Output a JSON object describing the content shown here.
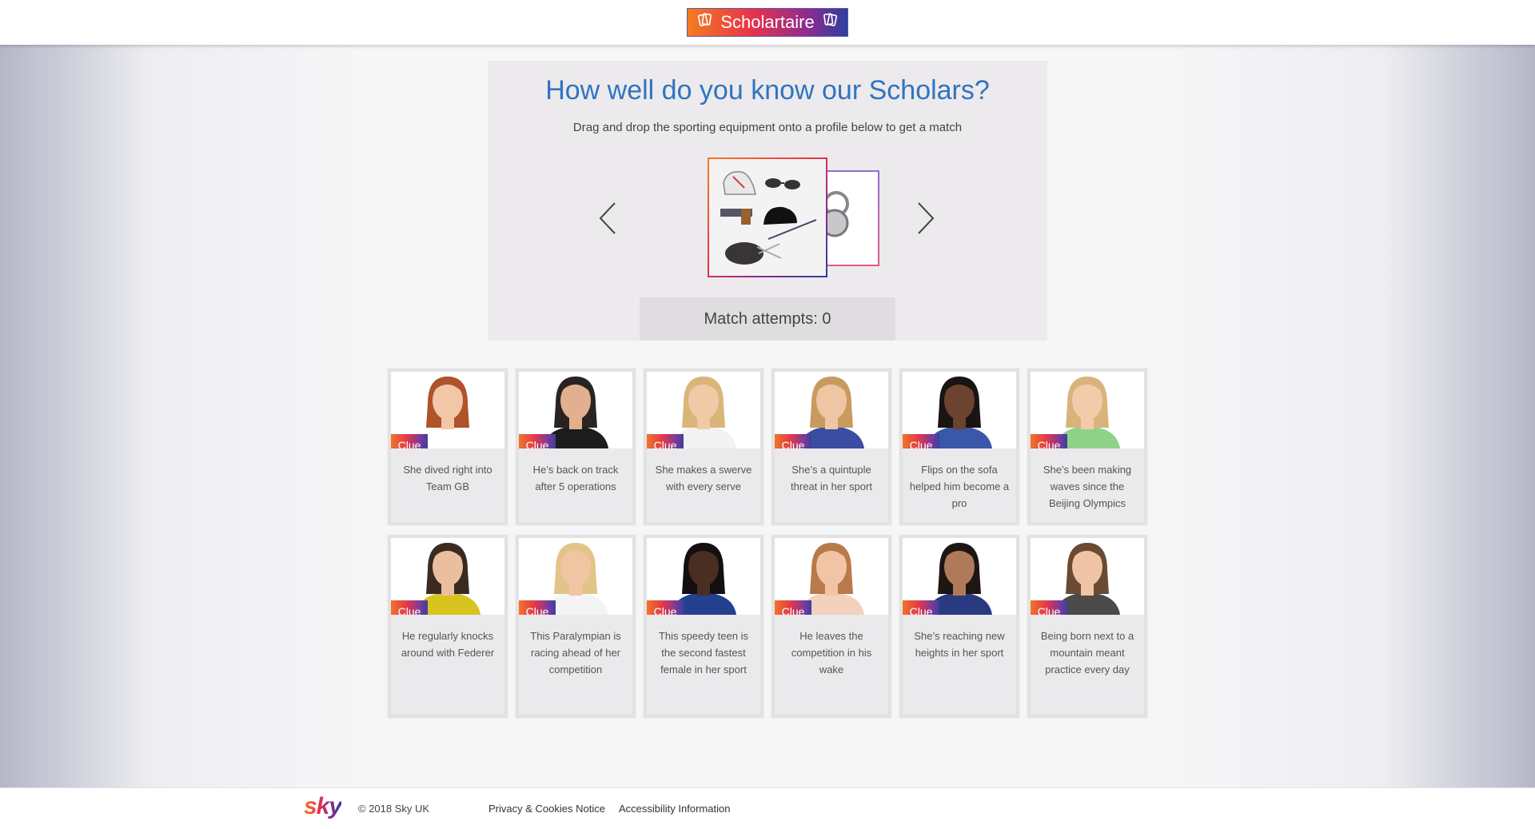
{
  "header": {
    "logo_text": "Scholartaire",
    "logo_icon": "card-icon"
  },
  "panel": {
    "title": "How well do you know our Scholars?",
    "subtitle": "Drag and drop the sporting equipment onto a profile below to get a match",
    "attempts_label": "Match attempts: 0",
    "prev_icon": "chevron-left-icon",
    "next_icon": "chevron-right-icon"
  },
  "clue_label": "Clue",
  "profiles": [
    {
      "desc": "She dived right into Team GB",
      "hair": "#b0522a",
      "skin": "#f1c7a8",
      "top": "#ffffff"
    },
    {
      "desc": "He’s back on track after 5 operations",
      "hair": "#2a2421",
      "skin": "#e2b08e",
      "top": "#1c1c1c"
    },
    {
      "desc": "She makes a swerve with every serve",
      "hair": "#d9b678",
      "skin": "#f0c9a6",
      "top": "#f2f2f2"
    },
    {
      "desc": "She’s a quintuple threat in her sport",
      "hair": "#c89a5e",
      "skin": "#efc6a4",
      "top": "#3b4da0"
    },
    {
      "desc": "Flips on the sofa helped him become a pro",
      "hair": "#1a1412",
      "skin": "#6b4330",
      "top": "#3a57a8"
    },
    {
      "desc": "She’s been making waves since the Beijing Olympics",
      "hair": "#d8b47c",
      "skin": "#f2cbab",
      "top": "#8ed28a"
    },
    {
      "desc": "He regularly knocks around with Federer",
      "hair": "#3a2a20",
      "skin": "#eabf9e",
      "top": "#d8c420"
    },
    {
      "desc": "This Paralympian is racing ahead of her competition",
      "hair": "#e2c48a",
      "skin": "#f0c5a2",
      "top": "#f4f4f4"
    },
    {
      "desc": "This speedy teen is the second fastest female in her sport",
      "hair": "#141010",
      "skin": "#4a2e22",
      "top": "#23418e"
    },
    {
      "desc": "He leaves the competition in his wake",
      "hair": "#b87a4a",
      "skin": "#f0c4a4",
      "top": "#f2d2bc"
    },
    {
      "desc": "She’s reaching new heights in her sport",
      "hair": "#1e1612",
      "skin": "#b07a5a",
      "top": "#2a3a80"
    },
    {
      "desc": "Being born next to a mountain meant practice every day",
      "hair": "#6a4a30",
      "skin": "#eec4a4",
      "top": "#4a4a4a"
    }
  ],
  "footer": {
    "brand": "sky",
    "copyright": "© 2018 Sky UK",
    "links": [
      "Privacy & Cookies Notice",
      "Accessibility Information"
    ]
  }
}
